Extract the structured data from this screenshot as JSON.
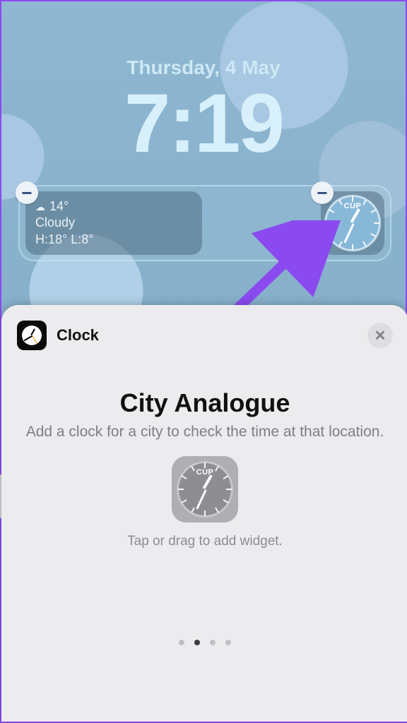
{
  "lockscreen": {
    "date": "Thursday, 4 May",
    "time": "7:19"
  },
  "widgets": {
    "weather": {
      "temp": "14°",
      "condition": "Cloudy",
      "hilo": "H:18° L:8°"
    },
    "clock": {
      "city_code": "CUP"
    }
  },
  "sheet": {
    "app_name": "Clock",
    "widget_title": "City Analogue",
    "widget_description": "Add a clock for a city to check the time at that location.",
    "preview_city_code": "CUP",
    "hint": "Tap or drag to add widget.",
    "page_count": 4,
    "page_index": 1
  },
  "colors": {
    "accent_arrow": "#8a4af0"
  }
}
